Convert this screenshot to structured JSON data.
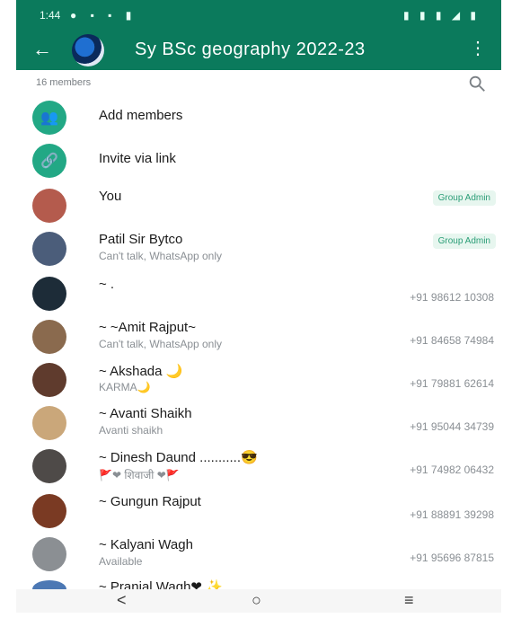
{
  "status_bar": {
    "time": "1:44",
    "left_icons": "● ▪ ▪ ▮",
    "right_icons": "▮ ▮ ▮ ◢ ▮"
  },
  "header": {
    "title": "Sy BSc geography 2022-23"
  },
  "members_count": "16 members",
  "actions": [
    {
      "label": "Add members"
    },
    {
      "label": "Invite via link"
    }
  ],
  "members": [
    {
      "name": "You",
      "status": "",
      "phone": "",
      "badge": "Group Admin",
      "avatar_color": "#b45b4d"
    },
    {
      "name": "Patil Sir Bytco",
      "status": "Can't talk, WhatsApp only",
      "phone": "",
      "badge": "Group Admin",
      "avatar_color": "#4b5d7a"
    },
    {
      "name": "~ .",
      "status": "",
      "phone": "+91 98612 10308",
      "badge": "",
      "avatar_color": "#1d2c38"
    },
    {
      "name": "~ ~Amit Rajput~",
      "status": "Can't talk, WhatsApp only",
      "phone": "+91 84658 74984",
      "badge": "",
      "avatar_color": "#8a6a4e"
    },
    {
      "name": "~ Akshada 🌙",
      "status": "KARMA🌙",
      "phone": "+91 79881 62614",
      "badge": "",
      "avatar_color": "#5f3b2d"
    },
    {
      "name": "~ Avanti Shaikh",
      "status": "Avanti shaikh",
      "phone": "+91 95044 34739",
      "badge": "",
      "avatar_color": "#caa77a"
    },
    {
      "name": "~ Dinesh Daund ...........😎",
      "status": "🚩❤ शिवाजी ❤🚩",
      "phone": "+91 74982 06432",
      "badge": "",
      "avatar_color": "#4e4a48"
    },
    {
      "name": "~ Gungun Rajput",
      "status": "",
      "phone": "+91 88891 39298",
      "badge": "",
      "avatar_color": "#7a3a23"
    },
    {
      "name": "~ Kalyani Wagh",
      "status": "Available",
      "phone": "+91 95696 87815",
      "badge": "",
      "avatar_color": "#8b8f93"
    },
    {
      "name": "~ Pranjal Wagh❤ ✨",
      "status": "",
      "phone": "",
      "badge": "",
      "avatar_color": "#4c78b4"
    }
  ],
  "nav": {
    "back": "<",
    "home": "○",
    "recents": "≡"
  }
}
